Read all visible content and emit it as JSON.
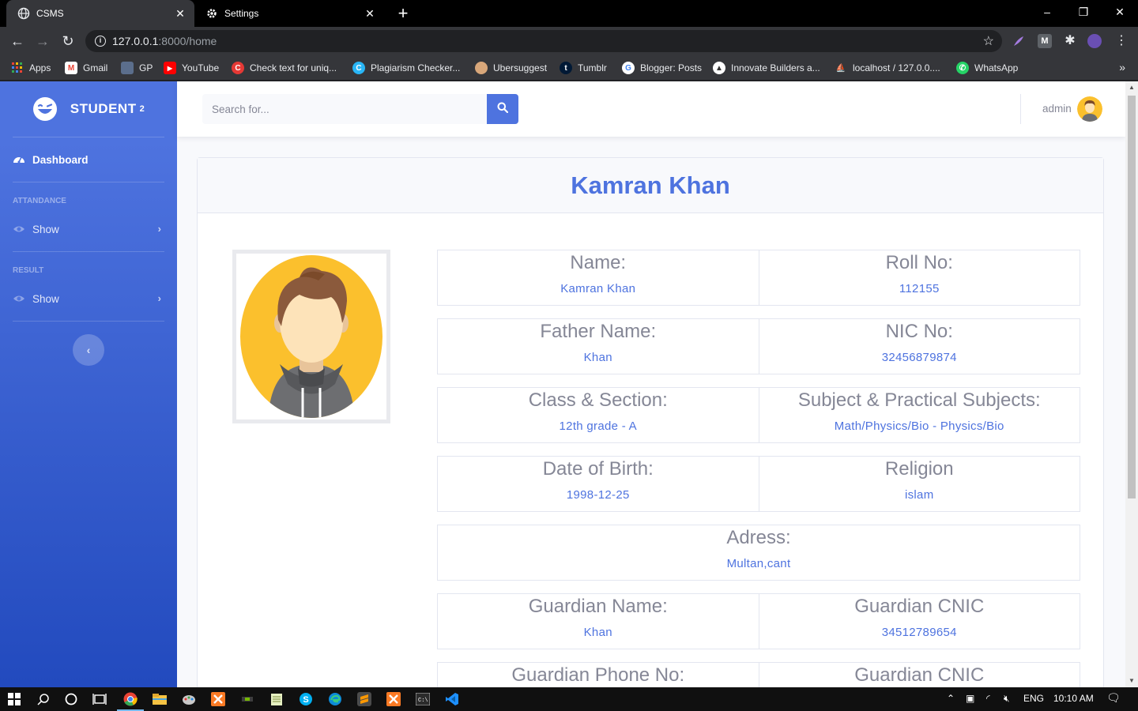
{
  "browser": {
    "tabs": [
      {
        "title": "CSMS",
        "active": true
      },
      {
        "title": "Settings",
        "active": false
      }
    ],
    "url_host": "127.0.0.1",
    "url_path": ":8000/home",
    "bookmarks": [
      "Apps",
      "Gmail",
      "GP",
      "YouTube",
      "Check text for uniq...",
      "Plagiarism Checker...",
      "Ubersuggest",
      "Tumblr",
      "Blogger: Posts",
      "Innovate Builders a...",
      "localhost / 127.0.0....",
      "WhatsApp"
    ]
  },
  "sidebar": {
    "brand": "STUDENT",
    "brand_sup": "2",
    "dashboard": "Dashboard",
    "attendance_heading": "ATTANDANCE",
    "attendance_show": "Show",
    "result_heading": "RESULT",
    "result_show": "Show"
  },
  "topbar": {
    "search_placeholder": "Search for...",
    "user": "admin"
  },
  "profile": {
    "title": "Kamran Khan",
    "rows": [
      [
        {
          "label": "Name:",
          "value": "Kamran Khan"
        },
        {
          "label": "Roll No:",
          "value": "112155"
        }
      ],
      [
        {
          "label": "Father Name:",
          "value": "Khan"
        },
        {
          "label": "NIC No:",
          "value": "32456879874"
        }
      ],
      [
        {
          "label": "Class & Section:",
          "value": "12th grade - A"
        },
        {
          "label": "Subject & Practical Subjects:",
          "value": "Math/Physics/Bio - Physics/Bio"
        }
      ],
      [
        {
          "label": "Date of Birth:",
          "value": "1998-12-25"
        },
        {
          "label": "Religion",
          "value": "islam"
        }
      ],
      [
        {
          "label": "Adress:",
          "value": "Multan,cant"
        }
      ],
      [
        {
          "label": "Guardian Name:",
          "value": "Khan"
        },
        {
          "label": "Guardian CNIC",
          "value": "34512789654"
        }
      ],
      [
        {
          "label": "Guardian Phone No:",
          "value": ""
        },
        {
          "label": "Guardian CNIC",
          "value": ""
        }
      ]
    ]
  },
  "taskbar": {
    "language": "ENG",
    "time": "10:10 AM"
  },
  "colors": {
    "primary": "#4e73df",
    "sidebar_dark": "#224abe",
    "label_gray": "#858796"
  }
}
